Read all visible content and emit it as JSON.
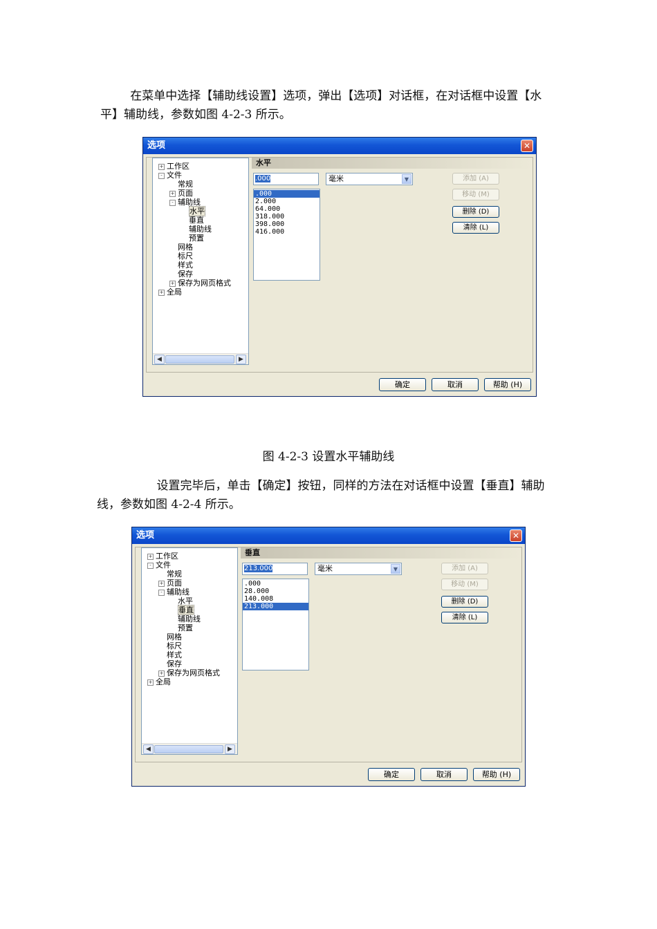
{
  "para1": "        在菜单中选择【辅助线设置】选项，弹出【选项】对话框，在对话框中设置【水平】辅助线，参数如图 4-2-3 所示。",
  "caption1": "图 4-2-3 设置水平辅助线",
  "para2": "                设置完毕后，单击【确定】按钮，同样的方法在对话框中设置【垂直】辅助线，参数如图 4-2-4 所示。",
  "dialog1": {
    "title": "选项",
    "section": "水平",
    "value": ".000",
    "unit": "毫米",
    "values": [
      ".000",
      "2.000",
      "64.000",
      "318.000",
      "398.000",
      "416.000"
    ],
    "selected_index": 0,
    "tree_selected": "水平"
  },
  "dialog2": {
    "title": "选项",
    "section": "垂直",
    "value": "213.000",
    "unit": "毫米",
    "values": [
      ".000",
      "28.000",
      "140.008",
      "213.000"
    ],
    "selected_index": 3,
    "tree_selected": "垂直"
  },
  "tree": [
    {
      "label": "工作区",
      "toggle": "+"
    },
    {
      "label": "文件",
      "toggle": "-"
    },
    {
      "label": "常规",
      "toggle": ""
    },
    {
      "label": "页面",
      "toggle": "+"
    },
    {
      "label": "辅助线",
      "toggle": "-"
    },
    {
      "label": "水平",
      "toggle": ""
    },
    {
      "label": "垂直",
      "toggle": ""
    },
    {
      "label": "辅助线",
      "toggle": ""
    },
    {
      "label": "预置",
      "toggle": ""
    },
    {
      "label": "网格",
      "toggle": ""
    },
    {
      "label": "标尺",
      "toggle": ""
    },
    {
      "label": "样式",
      "toggle": ""
    },
    {
      "label": "保存",
      "toggle": ""
    },
    {
      "label": "保存为网页格式",
      "toggle": "+"
    },
    {
      "label": "全局",
      "toggle": "+"
    }
  ],
  "buttons": {
    "add": "添加 (A)",
    "move": "移动 (M)",
    "delete": "删除 (D)",
    "clear": "清除 (L)",
    "ok": "确定",
    "cancel": "取消",
    "help": "帮助 (H)"
  },
  "icons": {
    "close": "close-icon",
    "dropdown": "chevron-down-icon",
    "scroll_left": "chevron-left-icon",
    "scroll_right": "chevron-right-icon"
  }
}
